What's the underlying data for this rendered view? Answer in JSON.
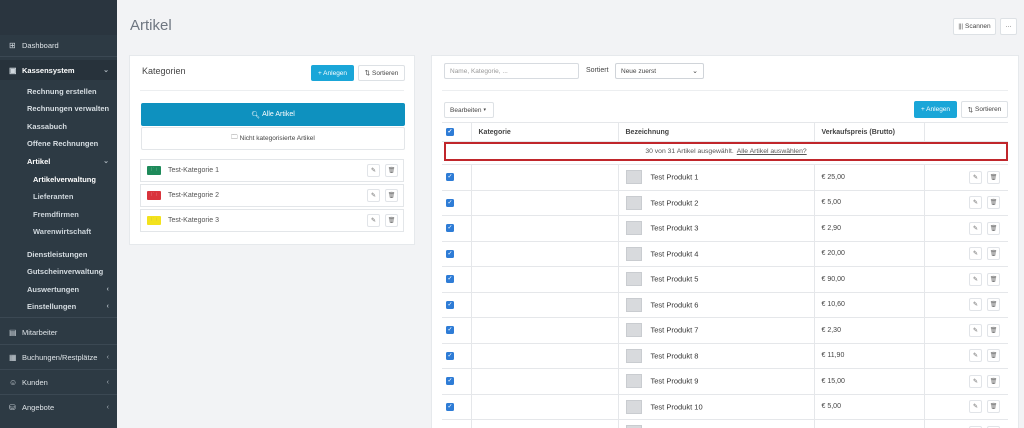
{
  "page": {
    "title": "Artikel"
  },
  "toolbar": {
    "scan_label": "Scannen",
    "more_label": "···"
  },
  "sidebar": {
    "dashboard": "Dashboard",
    "kassensystem": "Kassensystem",
    "items": [
      "Rechnung erstellen",
      "Rechnungen verwalten",
      "Kassabuch",
      "Offene Rechnungen",
      "Artikel"
    ],
    "artikel_sub": [
      "Artikelverwaltung",
      "Lieferanten",
      "Fremdfirmen",
      "Warenwirtschaft"
    ],
    "items2": [
      "Dienstleistungen",
      "Gutscheinverwaltung",
      "Auswertungen",
      "Einstellungen"
    ],
    "sections": [
      "Mitarbeiter",
      "Buchungen/Restplätze",
      "Kunden",
      "Angebote"
    ]
  },
  "categories": {
    "title": "Kategorien",
    "add_label": "+ Anlegen",
    "sort_label": "Sortieren",
    "all_label": "Alle Artikel",
    "uncategorized_label": "Nicht kategorisierte Artikel",
    "items": [
      {
        "name": "Test-Kategorie 1",
        "color": "#1e8a5a"
      },
      {
        "name": "Test-Kategorie 2",
        "color": "#d9343c"
      },
      {
        "name": "Test-Kategorie 3",
        "color": "#f3e21d"
      }
    ]
  },
  "articles": {
    "search_placeholder": "Name, Kategorie, ...",
    "sort_label": "Sortiert",
    "sort_value": "Neue zuerst",
    "edit_label": "Bearbeiten",
    "add_label": "+ Anlegen",
    "sort2_label": "Sortieren",
    "columns": [
      "Kategorie",
      "Bezeichnung",
      "Verkaufspreis (Brutto)"
    ],
    "selection_notice": "30 von 31 Artikel ausgewählt.",
    "select_all_link": "Alle Artikel auswählen?",
    "rows": [
      {
        "name": "Test Produkt 1",
        "price": "€ 25,00"
      },
      {
        "name": "Test Produkt 2",
        "price": "€ 5,00"
      },
      {
        "name": "Test Produkt 3",
        "price": "€ 2,90"
      },
      {
        "name": "Test Produkt 4",
        "price": "€ 20,00"
      },
      {
        "name": "Test Produkt 5",
        "price": "€ 90,00"
      },
      {
        "name": "Test Produkt 6",
        "price": "€ 10,60"
      },
      {
        "name": "Test Produkt 7",
        "price": "€ 2,30"
      },
      {
        "name": "Test Produkt 8",
        "price": "€ 11,90"
      },
      {
        "name": "Test Produkt 9",
        "price": "€ 15,00"
      },
      {
        "name": "Test Produkt 10",
        "price": "€ 5,00"
      },
      {
        "name": "",
        "price": ""
      }
    ]
  }
}
